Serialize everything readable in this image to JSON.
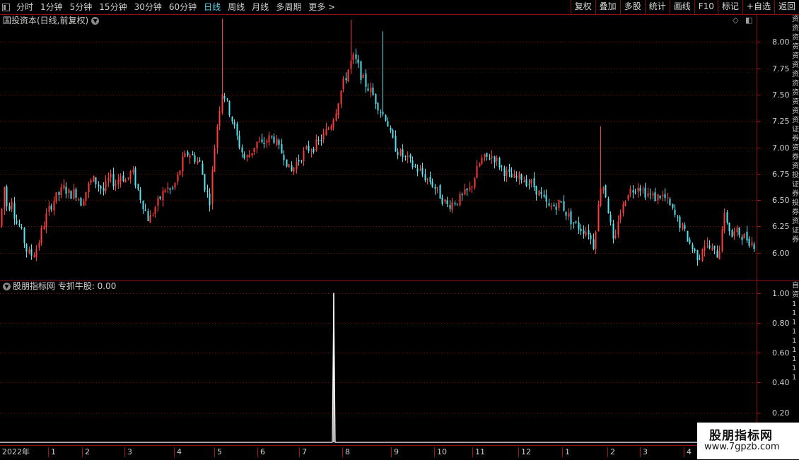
{
  "toolbar": {
    "periods": [
      {
        "label": "分时",
        "active": false
      },
      {
        "label": "1分钟",
        "active": false
      },
      {
        "label": "5分钟",
        "active": false
      },
      {
        "label": "15分钟",
        "active": false
      },
      {
        "label": "30分钟",
        "active": false
      },
      {
        "label": "60分钟",
        "active": false
      },
      {
        "label": "日线",
        "active": true
      },
      {
        "label": "周线",
        "active": false
      },
      {
        "label": "月线",
        "active": false
      },
      {
        "label": "多周期",
        "active": false
      },
      {
        "label": "更多 >",
        "active": false
      }
    ],
    "buttons": [
      "复权",
      "叠加",
      "多股",
      "统计",
      "画线",
      "F10",
      "标记",
      "+自选",
      "返回"
    ]
  },
  "main_chart": {
    "title": "国投资本(日线,前复权)",
    "y_labels": [
      "8.00",
      "7.75",
      "7.50",
      "7.25",
      "7.00",
      "6.75",
      "6.50",
      "6.25",
      "6.00"
    ]
  },
  "indicator": {
    "title": "股朋指标网  专抓牛股: 0.00",
    "y_labels": [
      "1.00",
      "0.80",
      "0.60",
      "0.40",
      "0.20"
    ]
  },
  "date_axis": {
    "labels": [
      "2022年",
      "1",
      "2",
      "3",
      "4",
      "5",
      "6",
      "7",
      "8",
      "9",
      "10",
      "11",
      "12",
      "1",
      "2",
      "3",
      "4"
    ]
  },
  "side_strip": {
    "top_text": "资资资资资资资资资资资资证券资券资投证券投券资证券",
    "bottom_text": "自资111111111"
  },
  "watermark": {
    "line1": "股朋指标网",
    "line2": "www.7gpzb.com"
  },
  "colors": {
    "up": "#ff3c3c",
    "down": "#54e4f0",
    "grid": "#8a1010",
    "signal": "#ffffff"
  },
  "chart_data": [
    {
      "type": "candlestick",
      "ylim": [
        5.75,
        8.25
      ],
      "y_ticks": [
        6.0,
        6.25,
        6.5,
        6.75,
        7.0,
        7.25,
        7.5,
        7.75,
        8.0
      ],
      "approx_high": 8.2,
      "approx_low": 5.85,
      "anchors": [
        [
          0,
          6.25
        ],
        [
          5,
          6.65
        ],
        [
          10,
          6.4
        ],
        [
          16,
          6.52
        ],
        [
          21,
          6.3
        ],
        [
          27,
          6.25
        ],
        [
          33,
          6.12
        ],
        [
          38,
          6.0
        ],
        [
          45,
          5.98
        ],
        [
          52,
          6.05
        ],
        [
          60,
          6.25
        ],
        [
          68,
          6.4
        ],
        [
          75,
          6.5
        ],
        [
          82,
          6.55
        ],
        [
          90,
          6.62
        ],
        [
          98,
          6.55
        ],
        [
          106,
          6.58
        ],
        [
          114,
          6.48
        ],
        [
          122,
          6.6
        ],
        [
          130,
          6.7
        ],
        [
          138,
          6.65
        ],
        [
          146,
          6.58
        ],
        [
          154,
          6.72
        ],
        [
          162,
          6.65
        ],
        [
          170,
          6.74
        ],
        [
          178,
          6.68
        ],
        [
          186,
          6.78
        ],
        [
          194,
          6.6
        ],
        [
          202,
          6.45
        ],
        [
          210,
          6.3
        ],
        [
          218,
          6.42
        ],
        [
          226,
          6.52
        ],
        [
          234,
          6.62
        ],
        [
          242,
          6.58
        ],
        [
          250,
          6.7
        ],
        [
          258,
          6.88
        ],
        [
          266,
          6.95
        ],
        [
          274,
          6.9
        ],
        [
          282,
          6.85
        ],
        [
          290,
          6.6
        ],
        [
          296,
          6.5
        ],
        [
          302,
          6.95
        ],
        [
          308,
          7.3
        ],
        [
          314,
          7.55
        ],
        [
          320,
          7.42
        ],
        [
          326,
          7.3
        ],
        [
          332,
          7.15
        ],
        [
          338,
          7.02
        ],
        [
          346,
          6.88
        ],
        [
          354,
          6.95
        ],
        [
          362,
          7.05
        ],
        [
          370,
          7.02
        ],
        [
          378,
          7.08
        ],
        [
          386,
          7.1
        ],
        [
          394,
          6.98
        ],
        [
          402,
          6.92
        ],
        [
          410,
          6.75
        ],
        [
          418,
          6.85
        ],
        [
          426,
          6.92
        ],
        [
          434,
          6.98
        ],
        [
          442,
          7.0
        ],
        [
          450,
          7.05
        ],
        [
          458,
          7.12
        ],
        [
          466,
          7.2
        ],
        [
          474,
          7.35
        ],
        [
          482,
          7.55
        ],
        [
          490,
          7.7
        ],
        [
          498,
          7.85
        ],
        [
          504,
          7.8
        ],
        [
          510,
          7.68
        ],
        [
          516,
          7.6
        ],
        [
          522,
          7.55
        ],
        [
          528,
          7.48
        ],
        [
          534,
          7.4
        ],
        [
          540,
          7.32
        ],
        [
          546,
          7.28
        ],
        [
          552,
          7.1
        ],
        [
          560,
          6.98
        ],
        [
          568,
          6.92
        ],
        [
          576,
          6.88
        ],
        [
          584,
          6.82
        ],
        [
          592,
          6.78
        ],
        [
          600,
          6.72
        ],
        [
          608,
          6.68
        ],
        [
          616,
          6.6
        ],
        [
          624,
          6.52
        ],
        [
          632,
          6.45
        ],
        [
          640,
          6.48
        ],
        [
          648,
          6.5
        ],
        [
          656,
          6.55
        ],
        [
          664,
          6.6
        ],
        [
          672,
          6.75
        ],
        [
          680,
          6.88
        ],
        [
          688,
          6.9
        ],
        [
          696,
          6.92
        ],
        [
          704,
          6.85
        ],
        [
          712,
          6.78
        ],
        [
          720,
          6.72
        ],
        [
          728,
          6.7
        ],
        [
          736,
          6.72
        ],
        [
          744,
          6.68
        ],
        [
          752,
          6.65
        ],
        [
          760,
          6.58
        ],
        [
          768,
          6.5
        ],
        [
          776,
          6.42
        ],
        [
          784,
          6.45
        ],
        [
          792,
          6.48
        ],
        [
          800,
          6.38
        ],
        [
          808,
          6.3
        ],
        [
          816,
          6.25
        ],
        [
          824,
          6.22
        ],
        [
          832,
          6.2
        ],
        [
          838,
          6.05
        ],
        [
          844,
          6.35
        ],
        [
          850,
          6.7
        ],
        [
          856,
          6.55
        ],
        [
          862,
          6.3
        ],
        [
          868,
          6.02
        ],
        [
          874,
          6.35
        ],
        [
          880,
          6.42
        ],
        [
          886,
          6.58
        ],
        [
          894,
          6.6
        ],
        [
          902,
          6.65
        ],
        [
          910,
          6.58
        ],
        [
          918,
          6.55
        ],
        [
          926,
          6.52
        ],
        [
          934,
          6.55
        ],
        [
          942,
          6.5
        ],
        [
          950,
          6.4
        ],
        [
          958,
          6.3
        ],
        [
          966,
          6.22
        ],
        [
          974,
          6.1
        ],
        [
          982,
          6.0
        ],
        [
          988,
          5.95
        ],
        [
          994,
          6.1
        ],
        [
          1002,
          6.05
        ],
        [
          1010,
          6.0
        ],
        [
          1016,
          5.98
        ],
        [
          1022,
          6.35
        ],
        [
          1028,
          6.3
        ],
        [
          1034,
          6.15
        ],
        [
          1040,
          6.2
        ],
        [
          1046,
          6.18
        ],
        [
          1052,
          6.15
        ],
        [
          1058,
          6.12
        ],
        [
          1066,
          6.08
        ]
      ],
      "spikes": [
        [
          314,
          8.22
        ],
        [
          497,
          8.21
        ],
        [
          542,
          8.1
        ],
        [
          850,
          7.2
        ]
      ]
    },
    {
      "type": "line",
      "name": "专抓牛股",
      "ylim": [
        0,
        1.05
      ],
      "y_ticks": [
        0.2,
        0.4,
        0.6,
        0.8,
        1.0
      ],
      "value_series": "zero everywhere except one spike",
      "spike_value": 1.0,
      "spike_month_label": "8"
    }
  ]
}
